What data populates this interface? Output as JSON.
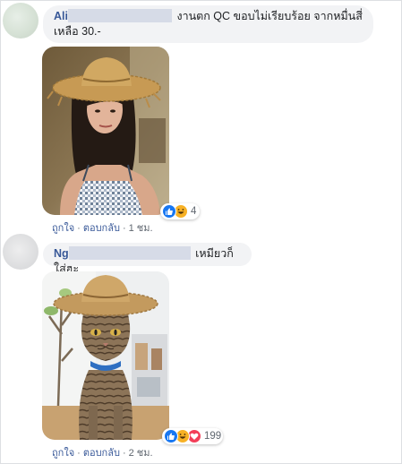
{
  "comments": [
    {
      "author_visible": "Ali",
      "text": "งานตก QC ขอบไม่เรียบร้อย จากหมื่นสี่เหลือ 30.-",
      "reactions_count": "4",
      "like_label": "ถูกใจ",
      "reply_label": "ตอบกลับ",
      "time": "1 ชม."
    },
    {
      "author_visible": "Ng",
      "text": "เหมียวก็ใส่ฮะ",
      "reactions_count": "199",
      "like_label": "ถูกใจ",
      "reply_label": "ตอบกลับ",
      "time": "2 ชม."
    }
  ],
  "separator": "·",
  "icons": {
    "reaction_like": "like-reaction-icon",
    "reaction_haha": "haha-reaction-icon",
    "reaction_love": "love-reaction-icon"
  },
  "colors": {
    "author": "#385898",
    "bubble": "#f2f3f5",
    "like_blue": "#1877f2",
    "love_red": "#f33e58",
    "haha_yellow": "#f7b125"
  }
}
